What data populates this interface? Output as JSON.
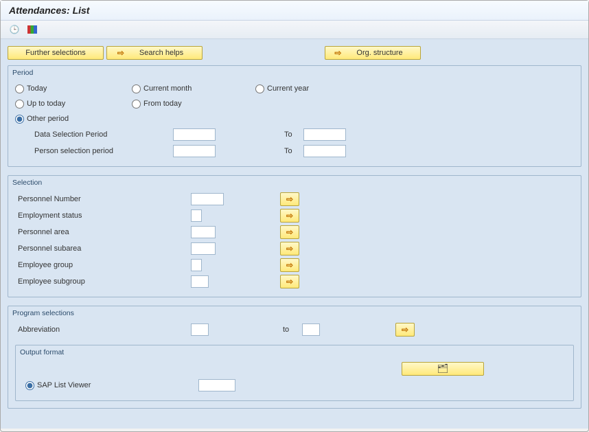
{
  "title": "Attendances: List",
  "top_buttons": {
    "further": "Further selections",
    "search_helps": "Search helps",
    "org_structure": "Org. structure"
  },
  "period": {
    "legend": "Period",
    "options": {
      "today": "Today",
      "current_month": "Current month",
      "current_year": "Current year",
      "up_to_today": "Up to today",
      "from_today": "From today",
      "other_period": "Other period"
    },
    "selected": "other_period",
    "fields": {
      "data_sel": {
        "label": "Data Selection Period",
        "from": "",
        "to_label": "To",
        "to": ""
      },
      "person_sel": {
        "label": "Person selection period",
        "from": "",
        "to_label": "To",
        "to": ""
      }
    }
  },
  "selection": {
    "legend": "Selection",
    "rows": [
      {
        "label": "Personnel Number",
        "value": "",
        "width": "w-med"
      },
      {
        "label": "Employment status",
        "value": "",
        "width": "w-tiny"
      },
      {
        "label": "Personnel area",
        "value": "",
        "width": "w-small"
      },
      {
        "label": "Personnel subarea",
        "value": "",
        "width": "w-small"
      },
      {
        "label": "Employee group",
        "value": "",
        "width": "w-tiny"
      },
      {
        "label": "Employee subgroup",
        "value": "",
        "width": "w-abbr"
      }
    ]
  },
  "program": {
    "legend": "Program selections",
    "abbrev": {
      "label": "Abbreviation",
      "from": "",
      "to_label": "to",
      "to": ""
    },
    "output": {
      "legend": "Output format",
      "option_label": "SAP List Viewer",
      "value": ""
    }
  }
}
